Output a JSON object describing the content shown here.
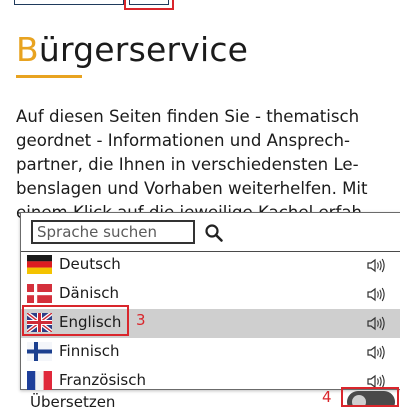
{
  "page": {
    "title_first_letter": "B",
    "title_rest": "ürgerservice",
    "intro_lines": [
      "Auf diesen Seiten finden Sie - thematisch",
      "geordnet - Informationen und Ansprech-",
      "partner, die Ihnen in verschiedensten Le-",
      "benslagen und Vorhaben weiterhelfen. Mit",
      "einem Klick auf die jeweilige Kachel erfah-"
    ]
  },
  "language_picker": {
    "search_placeholder": "Sprache suchen",
    "languages": [
      {
        "label": "Deutsch",
        "flag": "de",
        "selected": false
      },
      {
        "label": "Dänisch",
        "flag": "dk",
        "selected": false
      },
      {
        "label": "Englisch",
        "flag": "gb",
        "selected": true
      },
      {
        "label": "Finnisch",
        "flag": "fi",
        "selected": false
      },
      {
        "label": "Französisch",
        "flag": "fr",
        "selected": false
      }
    ]
  },
  "annotations": {
    "step_3": "3",
    "step_4": "4"
  },
  "bottom": {
    "partial_label": "Übersetzen"
  },
  "colors": {
    "accent": "#e8a320",
    "annotation_red": "#d9262c",
    "selected_row": "#cfcfcf"
  }
}
